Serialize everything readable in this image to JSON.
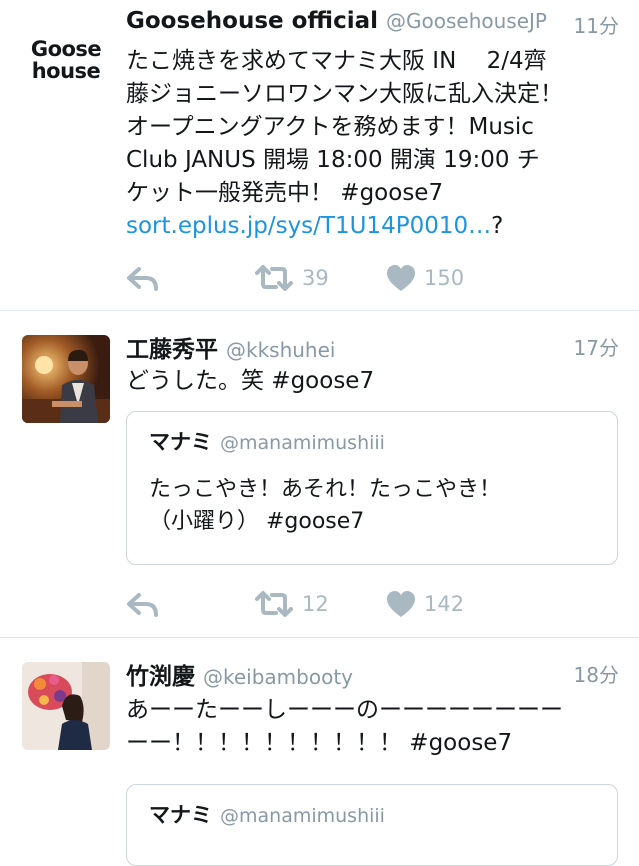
{
  "tweets": [
    {
      "name": "Goosehouse official",
      "handle": "@GoosehouseJP",
      "time": "11分",
      "text_lines": [
        "たこ焼きを求めてマナミ大阪 IN　 2/4齊",
        "藤ジョニーソロワンマン大阪に乱入決定！",
        "オープニングアクトを務めます！Music",
        "Club JANUS  開場 18:00  開演 19:00 チ",
        "ケット一般発売中！ #goose7"
      ],
      "link": "sort.eplus.jp/sys/T1U14P0010…",
      "link_suffix": "?",
      "logo_line1": "Goose",
      "logo_line2": "house",
      "retweets": "39",
      "likes": "150"
    },
    {
      "name": "工藤秀平",
      "handle": "@kkshuhei",
      "time": "17分",
      "text": "どうした。笑 #goose7",
      "quote": {
        "name": "マナミ",
        "handle": "@manamimushiii",
        "text_lines": [
          "たっこやき！あそれ！たっこやき！",
          "（小躍り） #goose7"
        ]
      },
      "retweets": "12",
      "likes": "142"
    },
    {
      "name": "竹渕慶",
      "handle": "@keibambooty",
      "time": "18分",
      "text_lines": [
        "あーーたーーしーーーのーーーーーーーー",
        "ーー！！！！！！！！！！ #goose7"
      ],
      "quote": {
        "name": "マナミ",
        "handle": "@manamimushiii"
      }
    }
  ],
  "colors": {
    "link": "#1b95e0",
    "secondary_text": "#8899a6",
    "icon": "#aab8c2",
    "divider": "#e1e8ed"
  },
  "icons": [
    "reply-icon",
    "retweet-icon",
    "like-icon"
  ]
}
